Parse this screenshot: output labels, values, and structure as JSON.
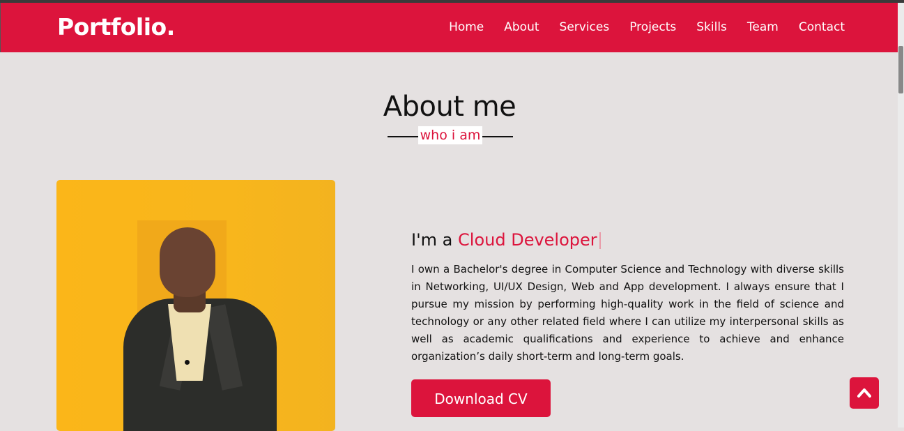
{
  "header": {
    "logo": "Portfolio.",
    "nav": [
      "Home",
      "About",
      "Services",
      "Projects",
      "Skills",
      "Team",
      "Contact"
    ]
  },
  "about": {
    "title": "About me",
    "subtitle": "who i am",
    "intro_prefix": "I'm a ",
    "intro_role": "Cloud Developer",
    "bio": "I own a Bachelor's degree in Computer Science and Technology with diverse skills in Networking, UI/UX Design, Web and App development. I always ensure that I pursue my mission by performing high-quality work in the field of science and technology or any other related field where I can utilize my interpersonal skills as well as academic qualifications and experience to achieve and enhance organization’s daily short-term and long-term goals.",
    "cv_button": "Download CV"
  },
  "icons": {
    "scroll_top": "chevron-up-icon",
    "portrait": "profile-photo"
  },
  "colors": {
    "accent": "#dc143c",
    "background": "#e5e1e1",
    "photo_bg": "#fbb619"
  }
}
